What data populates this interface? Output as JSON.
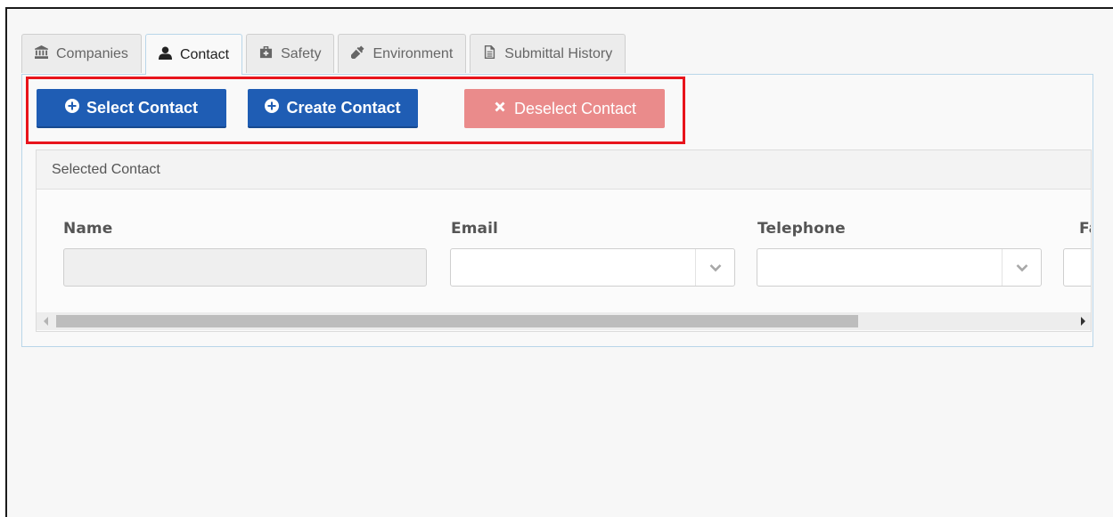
{
  "tabs": [
    {
      "label": "Companies",
      "icon": "bank-icon",
      "active": false
    },
    {
      "label": "Contact",
      "icon": "user-icon",
      "active": true
    },
    {
      "label": "Safety",
      "icon": "briefcase-medical-icon",
      "active": false
    },
    {
      "label": "Environment",
      "icon": "eyedropper-icon",
      "active": false
    },
    {
      "label": "Submittal History",
      "icon": "document-icon",
      "active": false
    }
  ],
  "toolbar": {
    "select_label": "Select Contact",
    "create_label": "Create Contact",
    "deselect_label": "Deselect Contact"
  },
  "selected_contact": {
    "title": "Selected Contact",
    "fields": [
      {
        "label": "Name",
        "value": ""
      },
      {
        "label": "Email",
        "value": ""
      },
      {
        "label": "Telephone",
        "value": ""
      },
      {
        "label": "Fax",
        "value": ""
      }
    ]
  },
  "colors": {
    "primary": "#1f5db4",
    "danger_disabled": "#ea8b8b",
    "highlight": "#e8141c",
    "tab_border_active": "#b9d6e9"
  }
}
